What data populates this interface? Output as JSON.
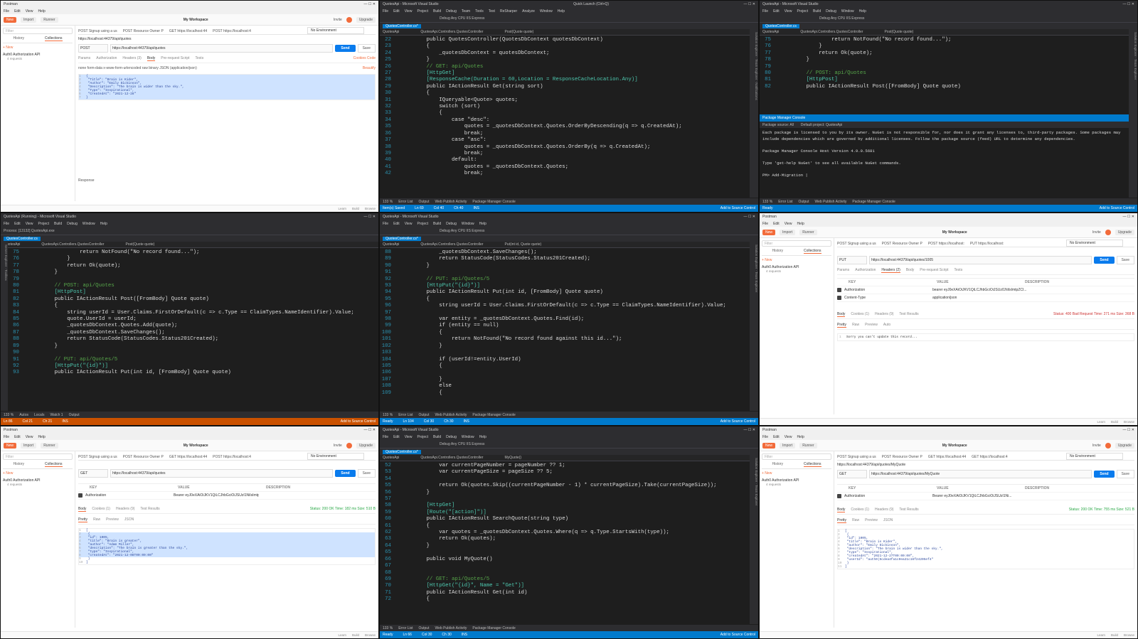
{
  "tiles": {
    "pm_send_post": {
      "title": "Postman",
      "menu": [
        "File",
        "Edit",
        "View",
        "Help"
      ],
      "toolbar": {
        "new": "New",
        "import": "Import",
        "runner": "Runner",
        "workspace": "My Workspace",
        "invite": "Invite",
        "upgrade": "Upgrade"
      },
      "sidebar": {
        "filter": "Filter",
        "tab_history": "History",
        "tab_collections": "Collections",
        "new_link": "+ New",
        "collection": "Auth0 Authorization API",
        "collection_sub": "4 requests"
      },
      "tabs": [
        "POST Signup using a us",
        "POST Resource Owner P",
        "GET https://localhost:44",
        "POST https://localhost:4"
      ],
      "env": "No Environment",
      "breadcrumb": "https://localhost:44379/api/quotes",
      "method": "POST",
      "url": "https://localhost:44379/api/quotes",
      "send": "Send",
      "save": "Save",
      "subtabs": [
        "Params",
        "Authorization",
        "Headers (3)",
        "Body",
        "Pre-request Script",
        "Tests"
      ],
      "subtabs_right": "Cookies  Code",
      "body_types": "none   form-data   x-www-form-urlencoded   raw   binary   JSON (application/json)",
      "beautify": "Beautify",
      "code": [
        "{",
        "  \"Title\": \"Brain is Kider\",",
        "  \"Author\": \"Emily Dickinson\",",
        "  \"Description\": \"The brain is wider than the sky.\",",
        "  \"Type\": \"Inspirational\",",
        "  \"CreatedAt\": \"2021-12-28\"",
        "}"
      ],
      "response_label": "Response",
      "status": [
        "Learn",
        "Build",
        "Browse"
      ]
    },
    "vs_controller": {
      "title": "QuotesApi - Microsoft Visual Studio",
      "quick_launch": "Quick Launch (Ctrl+Q)",
      "menu": [
        "File",
        "Edit",
        "View",
        "Project",
        "Build",
        "Debug",
        "Team",
        "Tools",
        "Test",
        "ReSharper",
        "Analyze",
        "Window",
        "Help"
      ],
      "toolbar": "Debug   Any CPU   IIS Express",
      "doctab": "QuotesController.cs*",
      "nav": [
        "QuotesApi",
        "QuotesApi.Controllers.QuotesController",
        "Post(Quote quote)"
      ],
      "lines": [
        {
          "n": "22",
          "t": "        public QuotesController(QuotesDbContext quotesDbContext)"
        },
        {
          "n": "23",
          "t": "        {"
        },
        {
          "n": "24",
          "t": "            _quotesDbContext = quotesDbContext;"
        },
        {
          "n": "25",
          "t": "        }"
        },
        {
          "n": "26",
          "t": "        // GET: api/Quotes"
        },
        {
          "n": "27",
          "t": "        [HttpGet]"
        },
        {
          "n": "28",
          "t": "        [ResponseCache(Duration = 60,Location = ResponseCacheLocation.Any)]"
        },
        {
          "n": "29",
          "t": "        public IActionResult Get(string sort)"
        },
        {
          "n": "30",
          "t": "        {"
        },
        {
          "n": "31",
          "t": "            IQueryable<Quote> quotes;"
        },
        {
          "n": "32",
          "t": "            switch (sort)"
        },
        {
          "n": "33",
          "t": "            {"
        },
        {
          "n": "34",
          "t": "                case \"desc\":"
        },
        {
          "n": "35",
          "t": "                    quotes = _quotesDbContext.Quotes.OrderByDescending(q => q.CreatedAt);"
        },
        {
          "n": "36",
          "t": "                    break;"
        },
        {
          "n": "37",
          "t": "                case \"asc\":"
        },
        {
          "n": "38",
          "t": "                    quotes = _quotesDbContext.Quotes.OrderBy(q => q.CreatedAt);"
        },
        {
          "n": "39",
          "t": "                    break;"
        },
        {
          "n": "40",
          "t": "                default:"
        },
        {
          "n": "41",
          "t": "                    quotes = _quotesDbContext.Quotes;"
        },
        {
          "n": "42",
          "t": "                    break;"
        }
      ],
      "zoom": "133 %",
      "bottom_tabs": [
        "Error List",
        "Output",
        "Web Publish Activity",
        "Package Manager Console"
      ],
      "status": [
        "Item(s) Saved",
        "Ln 69",
        "Col 40",
        "Ch 40",
        "INS",
        "Add to Source Control"
      ]
    },
    "vs_console": {
      "title": "QuotesApi - Microsoft Visual Studio",
      "doctab": "QuotesController.cs",
      "nav": [
        "QuotesApi",
        "QuotesApi.Controllers.QuotesController",
        "Post(Quote quote)"
      ],
      "lines": [
        {
          "n": "75",
          "t": "                return NotFound(\"No record found...\");"
        },
        {
          "n": "76",
          "t": "            }"
        },
        {
          "n": "77",
          "t": "            return Ok(quote);"
        },
        {
          "n": "78",
          "t": "        }"
        },
        {
          "n": "79",
          "t": ""
        },
        {
          "n": "80",
          "t": "        // POST: api/Quotes"
        },
        {
          "n": "81",
          "t": "        [HttpPost]"
        },
        {
          "n": "82",
          "t": "        public IActionResult Post([FromBody] Quote quote)"
        }
      ],
      "console_title": "Package Manager Console",
      "console_source": "Package source: All",
      "console_project": "Default project: QuotesApi",
      "console_text": "Each package is licensed to you by its owner. NuGet is not responsible for, nor does it grant any licenses to, third-party packages. Some packages may include dependencies which are governed by additional licenses. Follow the package source (feed) URL to determine any dependencies.\n\nPackage Manager Console Host Version 4.9.0.5681\n\nType 'get-help NuGet' to see all available NuGet commands.\n\nPM> Add-Migration |",
      "zoom": "133 %",
      "bottom_tabs": [
        "Error List",
        "Output",
        "Web Publish Activity",
        "Package Manager Console"
      ],
      "status": [
        "Ready",
        "Add to Source Control"
      ]
    },
    "vs_debug": {
      "title": "QuotesApi (Running) - Microsoft Visual Studio",
      "doctab": "QuotesController.cs",
      "nav": [
        "QuotesApi",
        "QuotesApi.Controllers.QuotesController",
        "Post(Quote quote)"
      ],
      "process": "Process: [13132] QuotesApi.exe",
      "lines": [
        {
          "n": "75",
          "t": "                return NotFound(\"No record found...\");"
        },
        {
          "n": "76",
          "t": "            }"
        },
        {
          "n": "77",
          "t": "            return Ok(quote);"
        },
        {
          "n": "78",
          "t": "        }"
        },
        {
          "n": "79",
          "t": ""
        },
        {
          "n": "80",
          "t": "        // POST: api/Quotes"
        },
        {
          "n": "81",
          "t": "        [HttpPost]"
        },
        {
          "n": "82",
          "t": "        public IActionResult Post([FromBody] Quote quote)"
        },
        {
          "n": "83",
          "t": "        {"
        },
        {
          "n": "84",
          "t": "            string userId = User.Claims.FirstOrDefault(c => c.Type == ClaimTypes.NameIdentifier).Value;"
        },
        {
          "n": "85",
          "t": "            quote.UserId = userId;"
        },
        {
          "n": "86",
          "t": "            _quotesDbContext.Quotes.Add(quote);"
        },
        {
          "n": "87",
          "t": "            _quotesDbContext.SaveChanges();"
        },
        {
          "n": "88",
          "t": "            return StatusCode(StatusCodes.Status201Created);"
        },
        {
          "n": "89",
          "t": "        }"
        },
        {
          "n": "90",
          "t": ""
        },
        {
          "n": "91",
          "t": "        // PUT: api/Quotes/5"
        },
        {
          "n": "92",
          "t": "        [HttpPut(\"{id}\")]"
        },
        {
          "n": "93",
          "t": "        public IActionResult Put(int id, [FromBody] Quote quote)"
        }
      ],
      "zoom": "133 %",
      "bottom_tabs": [
        "Autos",
        "Locals",
        "Watch 1",
        "Output"
      ],
      "status": [
        "Ln 86",
        "Col 21",
        "Ch 21",
        "INS",
        "Add to Source Control"
      ]
    },
    "vs_put": {
      "title": "QuotesApi - Microsoft Visual Studio",
      "doctab": "QuotesController.cs*",
      "nav": [
        "QuotesApi",
        "QuotesApi.Controllers.QuotesController",
        "Put(int id, Quote quote)"
      ],
      "lines": [
        {
          "n": "88",
          "t": "            _quotesDbContext.SaveChanges();"
        },
        {
          "n": "89",
          "t": "            return StatusCode(StatusCodes.Status201Created);"
        },
        {
          "n": "90",
          "t": "        }"
        },
        {
          "n": "91",
          "t": ""
        },
        {
          "n": "92",
          "t": "        // PUT: api/Quotes/5"
        },
        {
          "n": "93",
          "t": "        [HttpPut(\"{id}\")]"
        },
        {
          "n": "94",
          "t": "        public IActionResult Put(int id, [FromBody] Quote quote)"
        },
        {
          "n": "95",
          "t": "        {"
        },
        {
          "n": "96",
          "t": "            string userId = User.Claims.FirstOrDefault(c => c.Type == ClaimTypes.NameIdentifier).Value;"
        },
        {
          "n": "97",
          "t": ""
        },
        {
          "n": "98",
          "t": "            var entity = _quotesDbContext.Quotes.Find(id);"
        },
        {
          "n": "99",
          "t": "            if (entity == null)"
        },
        {
          "n": "100",
          "t": "            {"
        },
        {
          "n": "101",
          "t": "                return NotFound(\"No record found against this id...\");"
        },
        {
          "n": "102",
          "t": "            }"
        },
        {
          "n": "103",
          "t": ""
        },
        {
          "n": "104",
          "t": "            if (userId!=entity.UserId)"
        },
        {
          "n": "105",
          "t": "            {"
        },
        {
          "n": "106",
          "t": ""
        },
        {
          "n": "107",
          "t": "            }"
        },
        {
          "n": "108",
          "t": "            else"
        },
        {
          "n": "109",
          "t": "            {"
        }
      ],
      "zoom": "133 %",
      "bottom_tabs": [
        "Error List",
        "Output",
        "Web Publish Activity",
        "Package Manager Console"
      ],
      "status": [
        "Ready",
        "Ln 104",
        "Col 30",
        "Ch 30",
        "INS",
        "Add to Source Control"
      ]
    },
    "pm_put": {
      "title": "Postman",
      "tabs": [
        "POST Signup using a us",
        "POST Resource Owner P",
        "POST https://localhost:",
        "PUT https://localhost:"
      ],
      "env": "No Environment",
      "method": "PUT",
      "url": "https://localhost:44379/api/quotes/1005",
      "send": "Send",
      "save": "Save",
      "subtabs": [
        "Params",
        "Authorization",
        "Headers (2)",
        "Body",
        "Pre-request Script",
        "Tests"
      ],
      "headers": [
        {
          "key": "Authorization",
          "value": "bearer eyJ0eXAiOiJKV1QiLCJhbGciOiJSUzI1NiIsImtpZCI..."
        },
        {
          "key": "Content-Type",
          "value": "application/json"
        }
      ],
      "header_cols": [
        "KEY",
        "VALUE",
        "DESCRIPTION"
      ],
      "resp_tabs": [
        "Body",
        "Cookies (1)",
        "Headers (9)",
        "Test Results"
      ],
      "resp_status": "Status: 400 Bad Request   Time: 271 ms   Size: 368 B",
      "resp_views": [
        "Pretty",
        "Raw",
        "Preview",
        "Auto"
      ],
      "resp_text": "Sorry you can't update this record..."
    },
    "pm_get": {
      "title": "Postman",
      "tabs": [
        "POST Signup using a us",
        "POST Resource Owner P",
        "GET https://localhost:44",
        "POST https://localhost:4"
      ],
      "env": "No Environment",
      "method": "GET",
      "url": "https://localhost:44379/api/quotes",
      "send": "Send",
      "save": "Save",
      "header_cols": [
        "KEY",
        "VALUE",
        "DESCRIPTION"
      ],
      "header_key": "Authorization",
      "header_value": "Bearer eyJ0eXAiOiJKV1QiLCJhbGciOiJSUzI1NiIsImtpZCI6Ik...",
      "resp_tabs": [
        "Body",
        "Cookies (1)",
        "Headers (9)",
        "Test Results"
      ],
      "resp_status": "Status: 200 OK   Time: 182 ms   Size: 510 B",
      "resp_views": [
        "Pretty",
        "Raw",
        "Preview",
        "JSON"
      ],
      "code": [
        "[",
        "  {",
        "    \"id\": 1005,",
        "    \"title\": \"Brain is greater\",",
        "    \"author\": \"Adam Miller\",",
        "    \"description\": \"The brain is greater than the sky.\",",
        "    \"type\": \"Inspirational\",",
        "    \"createdAt\": \"2021-12-08T00:00:00\"",
        "  }",
        "]"
      ]
    },
    "vs_myquote": {
      "title": "QuotesApi - Microsoft Visual Studio",
      "doctab": "QuotesController.cs*",
      "nav": [
        "QuotesApi",
        "QuotesApi.Controllers.QuotesController",
        "MyQuote()"
      ],
      "lines": [
        {
          "n": "52",
          "t": "            var currentPageNumber = pageNumber ?? 1;"
        },
        {
          "n": "53",
          "t": "            var currentPageSize = pageSize ?? 5;"
        },
        {
          "n": "54",
          "t": ""
        },
        {
          "n": "55",
          "t": "            return Ok(quotes.Skip((currentPageNumber - 1) * currentPageSize).Take(currentPageSize));"
        },
        {
          "n": "56",
          "t": "        }"
        },
        {
          "n": "57",
          "t": ""
        },
        {
          "n": "58",
          "t": "        [HttpGet]"
        },
        {
          "n": "59",
          "t": "        [Route(\"[action]\")]"
        },
        {
          "n": "60",
          "t": "        public IActionResult SearchQuote(string type)"
        },
        {
          "n": "61",
          "t": "        {"
        },
        {
          "n": "62",
          "t": "            var quotes = _quotesDbContext.Quotes.Where(q => q.Type.StartsWith(type));"
        },
        {
          "n": "63",
          "t": "            return Ok(quotes);"
        },
        {
          "n": "64",
          "t": "        }"
        },
        {
          "n": "65",
          "t": ""
        },
        {
          "n": "66",
          "t": "        public void MyQuote()"
        },
        {
          "n": "67",
          "t": ""
        },
        {
          "n": "68",
          "t": ""
        },
        {
          "n": "69",
          "t": "        // GET: api/Quotes/5"
        },
        {
          "n": "70",
          "t": "        [HttpGet(\"{id}\", Name = \"Get\")]"
        },
        {
          "n": "71",
          "t": "        public IActionResult Get(int id)"
        },
        {
          "n": "72",
          "t": "        {"
        }
      ],
      "zoom": "133 %",
      "bottom_tabs": [
        "Error List",
        "Output",
        "Web Publish Activity",
        "Package Manager Console"
      ],
      "status": [
        "Ready",
        "Ln 66",
        "Col 30",
        "Ch 30",
        "INS",
        "Add to Source Control"
      ]
    },
    "pm_myquote": {
      "title": "Postman",
      "tabs": [
        "POST Signup using a us",
        "POST Resource Owner P",
        "GET https://localhost:44",
        "GET https://localhost:4"
      ],
      "env": "No Environment",
      "breadcrumb": "https://localhost:44379/api/quotes/MyQuote",
      "method": "GET",
      "url": "https://localhost:44379/api/quotes/MyQuote",
      "send": "Send",
      "save": "Save",
      "header_key": "Authorization",
      "header_value": "Bearer eyJ0eXAiOiJKV1QiLCJhbGciOiJSUzI1Ni...",
      "resp_tabs": [
        "Body",
        "Cookies (1)",
        "Headers (9)",
        "Test Results"
      ],
      "resp_status": "Status: 200 OK   Time: 755 ms   Size: 521 B",
      "resp_views": [
        "Pretty",
        "Raw",
        "Preview",
        "JSON"
      ],
      "code": [
        "[",
        "  {",
        "    \"id\": 1005,",
        "    \"title\": \"Brain is Kider\",",
        "    \"author\": \"Emily Dickinson\",",
        "    \"description\": \"The brain is wider than the sky.\",",
        "    \"type\": \"Inspirational\",",
        "    \"createdAt\": \"2021-12-27T00:00:00\",",
        "    \"userId\": \"auth0|5cdea4fa1c0ea21c16f24205ef4\"",
        "  }",
        "]"
      ]
    }
  }
}
